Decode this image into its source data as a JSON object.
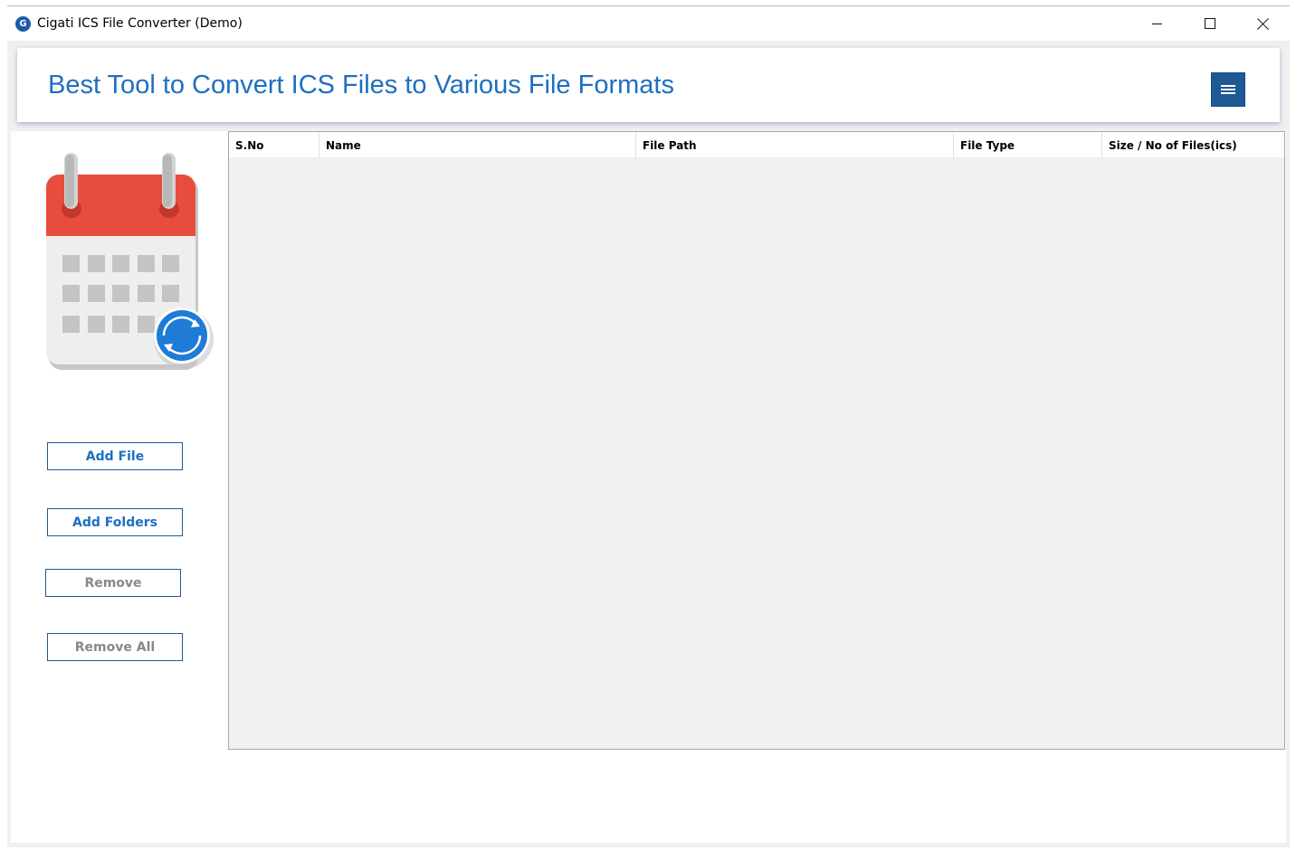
{
  "window": {
    "title": "Cigati ICS File Converter (Demo)",
    "icon_letter": "G"
  },
  "header": {
    "title": "Best Tool to Convert ICS Files to Various File Formats",
    "menu_icon": "hamburger-menu-icon"
  },
  "sidebar": {
    "illustration": "calendar-sync-icon",
    "buttons": {
      "add_file": "Add File",
      "add_folders": "Add Folders",
      "remove": "Remove",
      "remove_all": "Remove All"
    }
  },
  "table": {
    "columns": [
      "S.No",
      "Name",
      "File Path",
      "File Type",
      "Size / No of Files(ics)"
    ],
    "rows": []
  },
  "colors": {
    "accent": "#1e6fc0",
    "menu_button": "#1d5a95",
    "calendar_top": "#e84c3d",
    "sync_blue": "#1e7bd6",
    "disabled_text": "#888888"
  }
}
